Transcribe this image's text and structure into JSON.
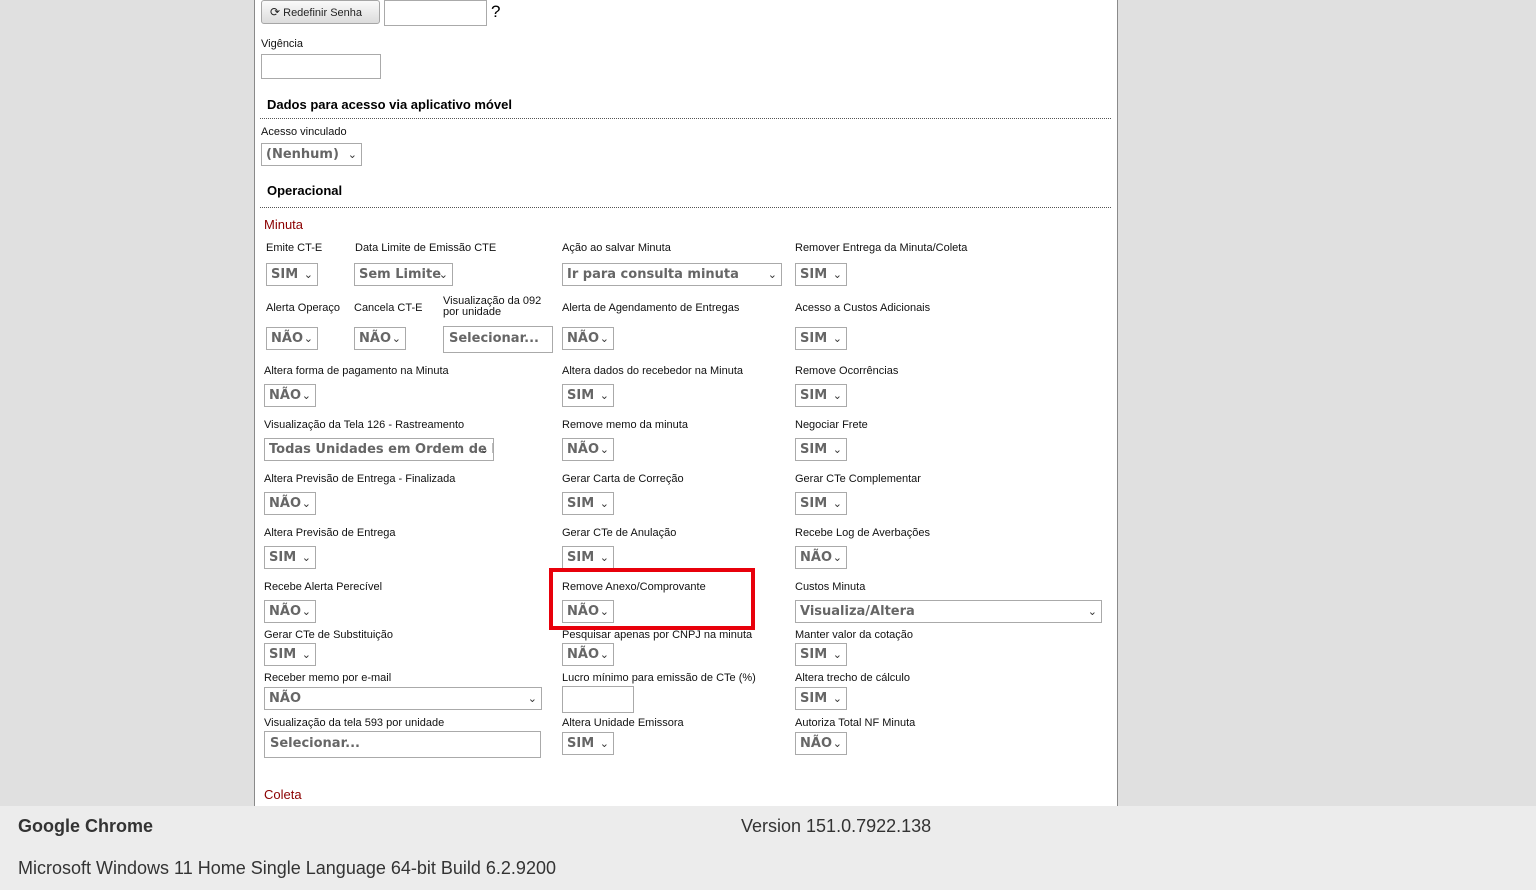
{
  "top": {
    "reset_button_label": "Redefinir Senha",
    "question_mark": "?",
    "vigencia_label": "Vigência"
  },
  "mobile_section": {
    "title": "Dados para acesso via aplicativo móvel",
    "linked_access_label": "Acesso vinculado",
    "linked_access_value": "(Nenhum)"
  },
  "operational_section": {
    "title": "Operacional"
  },
  "minuta": {
    "title": "Minuta",
    "fields": {
      "emite_cte": {
        "label": "Emite CT-E",
        "value": "SIM"
      },
      "data_limite": {
        "label": "Data Limite de Emissão CTE",
        "value": "Sem Limite"
      },
      "acao_salvar": {
        "label": "Ação ao salvar Minuta",
        "value": "Ir para consulta minuta"
      },
      "remover_entrega": {
        "label": "Remover Entrega da Minuta/Coleta",
        "value": "SIM"
      },
      "alerta_operaco": {
        "label": "Alerta Operaço",
        "value": "NÃO"
      },
      "cancela_cte": {
        "label": "Cancela CT-E",
        "value": "NÃO"
      },
      "visualizacao_092": {
        "label": "Visualização da 092 por unidade",
        "placeholder": "Selecionar..."
      },
      "alerta_agendamento": {
        "label": "Alerta de Agendamento de Entregas",
        "value": "NÃO"
      },
      "acesso_custos": {
        "label": "Acesso a Custos Adicionais",
        "value": "SIM"
      },
      "altera_forma_pagamento": {
        "label": "Altera forma de pagamento na Minuta",
        "value": "NÃO"
      },
      "altera_dados_recebedor": {
        "label": "Altera dados do recebedor na Minuta",
        "value": "SIM"
      },
      "remove_ocorrencias": {
        "label": "Remove Ocorrências",
        "value": "SIM"
      },
      "visualizacao_126": {
        "label": "Visualização da Tela 126 - Rastreamento",
        "value": "Todas Unidades em Ordem de Emissão"
      },
      "remove_memo": {
        "label": "Remove memo da minuta",
        "value": "NÃO"
      },
      "negociar_frete": {
        "label": "Negociar Frete",
        "value": "SIM"
      },
      "altera_previsao_finalizada": {
        "label": "Altera Previsão de Entrega - Finalizada",
        "value": "NÃO"
      },
      "gerar_carta": {
        "label": "Gerar Carta de Correção",
        "value": "SIM"
      },
      "gerar_cte_complementar": {
        "label": "Gerar CTe Complementar",
        "value": "SIM"
      },
      "altera_previsao": {
        "label": "Altera Previsão de Entrega",
        "value": "SIM"
      },
      "gerar_cte_anulacao": {
        "label": "Gerar CTe de Anulação",
        "value": "SIM"
      },
      "recebe_log": {
        "label": "Recebe Log de Averbações",
        "value": "NÃO"
      },
      "recebe_alerta": {
        "label": "Recebe Alerta Perecível",
        "value": "NÃO"
      },
      "remove_anexo": {
        "label": "Remove Anexo/Comprovante",
        "value": "NÃO"
      },
      "custos_minuta": {
        "label": "Custos Minuta",
        "value": "Visualiza/Altera"
      },
      "gerar_cte_substituicao": {
        "label": "Gerar CTe de Substituição",
        "value": "SIM"
      },
      "pesquisar_cnpj": {
        "label": "Pesquisar apenas por CNPJ na minuta",
        "value": "NÃO"
      },
      "manter_valor": {
        "label": "Manter valor da cotação",
        "value": "SIM"
      },
      "receber_memo_email": {
        "label": "Receber memo por e-mail",
        "value": "NÃO"
      },
      "lucro_minimo": {
        "label": "Lucro mínimo para emissão de CTe (%)",
        "value": ""
      },
      "altera_trecho": {
        "label": "Altera trecho de cálculo",
        "value": "SIM"
      },
      "visualizacao_593": {
        "label": "Visualização da tela 593 por unidade",
        "placeholder": "Selecionar..."
      },
      "altera_unidade": {
        "label": "Altera Unidade Emissora",
        "value": "SIM"
      },
      "autoriza_total": {
        "label": "Autoriza Total NF Minuta",
        "value": "NÃO"
      }
    }
  },
  "coleta": {
    "title": "Coleta"
  },
  "footer": {
    "browser_name": "Google Chrome",
    "version": "Version 151.0.7922.138",
    "os": "Microsoft Windows 11 Home Single Language 64-bit Build 6.2.9200"
  },
  "colors": {
    "accent_red": "#8b0000",
    "highlight": "#e8000b"
  }
}
